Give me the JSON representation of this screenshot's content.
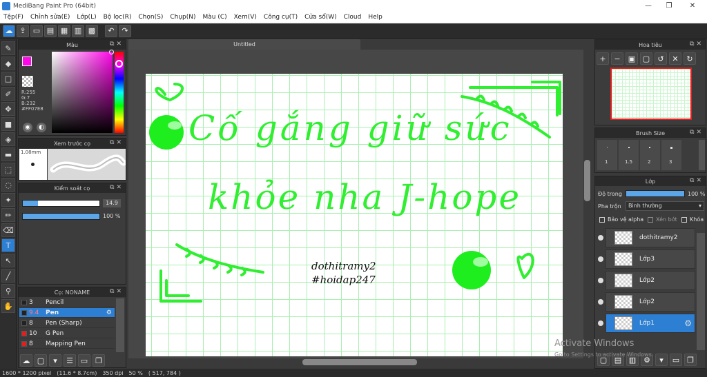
{
  "window": {
    "title": "MediBang Paint Pro (64bit)",
    "minimize": "—",
    "maximize": "❐",
    "close": "✕"
  },
  "menu": [
    "Tệp(F)",
    "Chỉnh sửa(E)",
    "Lớp(L)",
    "Bộ lọc(R)",
    "Chọn(S)",
    "Chụp(N)",
    "Màu (C)",
    "Xem(V)",
    "Công cụ(T)",
    "Cửa sổ(W)",
    "Cloud",
    "Help"
  ],
  "color_panel": {
    "title": "Màu",
    "r": "R:255",
    "g": "G:7",
    "b": "B:232",
    "hex": "#FF07E8",
    "primary": "#FF07E8"
  },
  "brush_preview_panel": {
    "title": "Xem trước cọ",
    "size": "1.08mm"
  },
  "brush_control_panel": {
    "title": "Kiểm soát cọ",
    "size_value": "14.9",
    "opacity_value": "100 %",
    "size_fill": 0.2,
    "opacity_fill": 1.0
  },
  "brush_list_panel": {
    "title": "Cọ: NONAME",
    "brushes": [
      {
        "num": "3",
        "name": "Pencil",
        "color": "#222222"
      },
      {
        "num": "9.4",
        "name": "Pen",
        "color": "#222222"
      },
      {
        "num": "8",
        "name": "Pen (Sharp)",
        "color": "#222222"
      },
      {
        "num": "10",
        "name": "G Pen",
        "color": "#e02020"
      },
      {
        "num": "8",
        "name": "Mapping Pen",
        "color": "#e02020"
      }
    ]
  },
  "document": {
    "tab": "Untitled"
  },
  "artwork": {
    "line1": "Cố gắng giữ sức",
    "line2": "khỏe nha J-hope",
    "sig1": "dothitramy2",
    "sig2": "#hoidap247",
    "ink": "#30ee30"
  },
  "navigator_panel": {
    "title": "Hoa tiêu"
  },
  "brush_size_panel": {
    "title": "Brush Size",
    "sizes": [
      "1",
      "1.5",
      "2",
      "3"
    ]
  },
  "layer_panel": {
    "title": "Lớp",
    "opacity_label": "Độ trong",
    "opacity_value": "100 %",
    "blend_label": "Pha trộn",
    "blend_value": "Bình thường",
    "protect_alpha": "Bảo vệ alpha",
    "clipping": "Xén bớt",
    "lock": "Khóa",
    "layers": [
      "dothitramy2",
      "Lớp3",
      "Lớp2",
      "Lớp2",
      "Lớp1"
    ]
  },
  "status": {
    "size": "1600 * 1200 pixel",
    "physical": "(11.6 * 8.7cm)",
    "dpi": "350 dpi",
    "zoom": "50 %",
    "cursor": "( 517, 784 )"
  },
  "watermark": {
    "line1": "Activate Windows",
    "line2": "Go to Settings to activate Windows."
  }
}
